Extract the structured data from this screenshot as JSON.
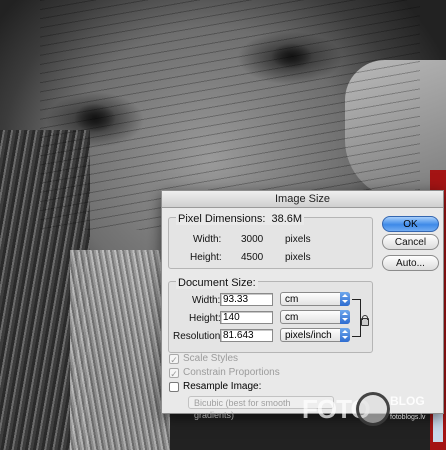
{
  "dialog": {
    "title": "Image Size",
    "pixel_dimensions": {
      "label": "Pixel Dimensions:",
      "size": "38.6M",
      "width_label": "Width:",
      "width_value": "3000",
      "width_unit": "pixels",
      "height_label": "Height:",
      "height_value": "4500",
      "height_unit": "pixels"
    },
    "document_size": {
      "label": "Document Size:",
      "width_label": "Width:",
      "width_value": "93.33",
      "width_unit": "cm",
      "height_label": "Height:",
      "height_value": "140",
      "height_unit": "cm",
      "resolution_label": "Resolution:",
      "resolution_value": "81.643",
      "resolution_unit": "pixels/inch"
    },
    "buttons": {
      "ok": "OK",
      "cancel": "Cancel",
      "auto": "Auto..."
    },
    "options": {
      "scale_styles": "Scale Styles",
      "constrain_proportions": "Constrain Proportions",
      "resample_image": "Resample Image:",
      "resample_method": "Bicubic (best for smooth gradients)",
      "check_mark": "✓"
    }
  },
  "watermark": {
    "foto": "FOTO",
    "blog": "BLOG",
    "site": "fotoblogs.lv"
  },
  "colors": {
    "accent": "#3e8ae8",
    "dialog_bg": "#e9e9e9",
    "side_bar": "#a41414"
  }
}
